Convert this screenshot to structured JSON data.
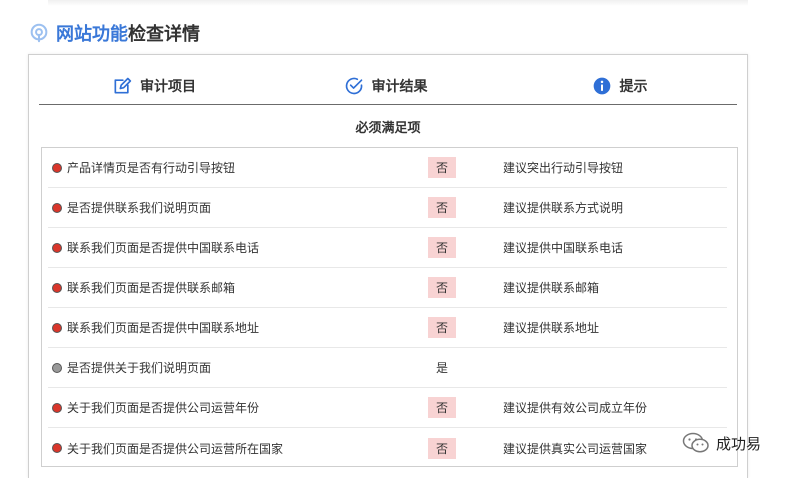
{
  "section": {
    "title_highlight": "网站功能",
    "title_rest": "检查详情"
  },
  "columns": [
    {
      "label": "审计项目",
      "icon": "edit-icon"
    },
    {
      "label": "审计结果",
      "icon": "check-circle-icon"
    },
    {
      "label": "提示",
      "icon": "info-icon"
    }
  ],
  "group_title": "必须满足项",
  "rows": [
    {
      "item": "产品详情页是否有行动引导按钮",
      "result": "否",
      "tip": "建议突出行动引导按钮",
      "status": "fail"
    },
    {
      "item": "是否提供联系我们说明页面",
      "result": "否",
      "tip": "建议提供联系方式说明",
      "status": "fail"
    },
    {
      "item": "联系我们页面是否提供中国联系电话",
      "result": "否",
      "tip": "建议提供中国联系电话",
      "status": "fail"
    },
    {
      "item": "联系我们页面是否提供联系邮箱",
      "result": "否",
      "tip": "建议提供联系邮箱",
      "status": "fail"
    },
    {
      "item": "联系我们页面是否提供中国联系地址",
      "result": "否",
      "tip": "建议提供联系地址",
      "status": "fail"
    },
    {
      "item": "是否提供关于我们说明页面",
      "result": "是",
      "tip": "",
      "status": "pass"
    },
    {
      "item": "关于我们页面是否提供公司运营年份",
      "result": "否",
      "tip": "建议提供有效公司成立年份",
      "status": "fail"
    },
    {
      "item": "关于我们页面是否提供公司运营所在国家",
      "result": "否",
      "tip": "建议提供真实公司运营国家",
      "status": "fail"
    }
  ],
  "watermark": {
    "text": "成功易"
  },
  "colors": {
    "accent": "#3a78d8",
    "fail_dot": "#d9362b",
    "pass_dot": "#999999",
    "fail_badge": "#f8d3d3"
  }
}
